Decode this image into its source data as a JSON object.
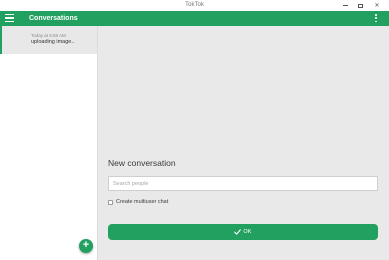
{
  "window": {
    "title": "TokTok",
    "minimize_icon": "minimize-icon",
    "maximize_icon": "maximize-icon",
    "close_icon": "close-icon",
    "close_glyph": "✕"
  },
  "appbar": {
    "title": "Conversations",
    "menu_icon": "hamburger-menu-icon",
    "more_icon": "more-vertical-icon",
    "color": "#21a060"
  },
  "sidebar": {
    "conversations": [
      {
        "time": "Today at 5:58 AM",
        "preview": "uploading image..",
        "selected": true
      }
    ],
    "fab": {
      "icon": "plus-icon",
      "glyph": "+"
    }
  },
  "main": {
    "heading": "New conversation",
    "search": {
      "placeholder": "Search people",
      "value": ""
    },
    "multiuser": {
      "label": "Create multiuser chat",
      "checked": false
    },
    "ok_button": {
      "label": "OK",
      "icon": "check-icon"
    }
  },
  "colors": {
    "accent": "#21a060",
    "main_background": "#e9e9e9",
    "selected_item_background": "#e8e8e8"
  }
}
